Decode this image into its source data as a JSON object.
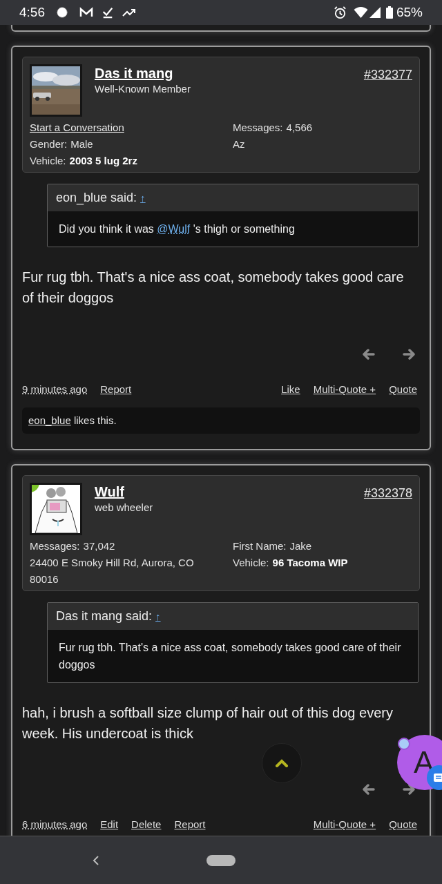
{
  "status_bar": {
    "time": "4:56",
    "battery": "65%"
  },
  "posts": [
    {
      "author": "Das it mang",
      "title": "Well-Known Member",
      "number": "#332377",
      "online": false,
      "info_left": [
        {
          "kind": "link",
          "text": "Start a Conversation"
        },
        {
          "kind": "field",
          "label": "Gender:",
          "value": "Male",
          "strong": false
        },
        {
          "kind": "field",
          "label": "Vehicle:",
          "value": "2003 5 lug 2rz",
          "strong": true
        }
      ],
      "info_right": [
        {
          "kind": "field",
          "label": "Messages:",
          "value": "4,566",
          "strong": false
        },
        {
          "kind": "text",
          "text": "Az"
        }
      ],
      "quote": {
        "author": "eon_blue said:",
        "jump": "↑",
        "segments": [
          {
            "kind": "text",
            "text": "Did you think it was "
          },
          {
            "kind": "mention",
            "text": "@Wulf"
          },
          {
            "kind": "text",
            "text": " 's thigh or something"
          }
        ]
      },
      "body": "Fur rug tbh. That's a nice ass coat, somebody takes good care of their doggos",
      "actions_left": [
        {
          "kind": "time",
          "text": "9 minutes ago"
        },
        {
          "kind": "link",
          "text": "Report"
        }
      ],
      "actions_right": [
        {
          "kind": "link",
          "text": "Like"
        },
        {
          "kind": "link",
          "text": "Multi-Quote +"
        },
        {
          "kind": "link",
          "text": "Quote"
        }
      ],
      "likes": {
        "user": "eon_blue",
        "text": " likes this."
      }
    },
    {
      "author": "Wulf",
      "title": "web wheeler",
      "number": "#332378",
      "online": true,
      "info_left": [
        {
          "kind": "field",
          "label": "Messages:",
          "value": "37,042",
          "strong": false
        },
        {
          "kind": "text",
          "text": "24400 E Smoky Hill Rd, Aurora, CO 80016"
        }
      ],
      "info_right": [
        {
          "kind": "field",
          "label": "First Name:",
          "value": "Jake",
          "strong": false
        },
        {
          "kind": "field",
          "label": "Vehicle:",
          "value": "96 Tacoma WIP",
          "strong": true
        }
      ],
      "quote": {
        "author": "Das it mang said:",
        "jump": "↑",
        "segments": [
          {
            "kind": "text",
            "text": "Fur rug tbh. That's a nice ass coat, somebody takes good care of their doggos"
          }
        ]
      },
      "body": "hah, i brush a softball size clump of hair out of this dog every week. His undercoat is thick",
      "actions_left": [
        {
          "kind": "time",
          "text": "6 minutes ago"
        },
        {
          "kind": "link",
          "text": "Edit"
        },
        {
          "kind": "link",
          "text": "Delete"
        },
        {
          "kind": "link",
          "text": "Report"
        }
      ],
      "actions_right": [
        {
          "kind": "link",
          "text": "Multi-Quote +"
        },
        {
          "kind": "link",
          "text": "Quote"
        }
      ]
    }
  ],
  "chat_head": {
    "letter": "A"
  }
}
